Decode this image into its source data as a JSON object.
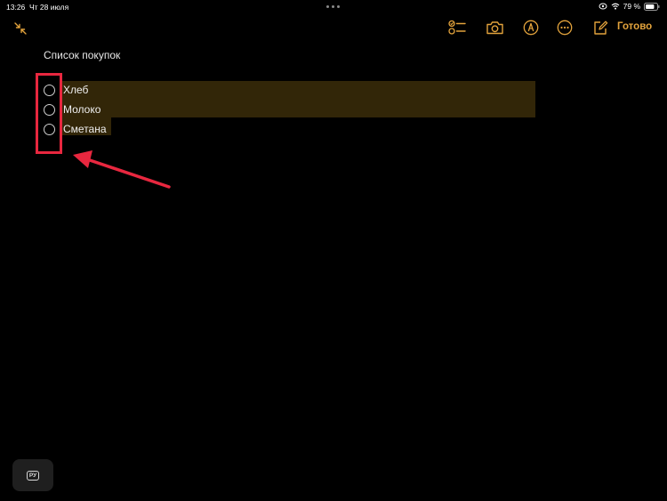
{
  "status_bar": {
    "time": "13:26",
    "date": "Чт 28 июля",
    "battery_percent": "79 %",
    "battery_level": 0.79
  },
  "toolbar": {
    "done_label": "Готово",
    "accent_color": "#e3a33c",
    "icons": [
      "collapse-icon",
      "checklist-icon",
      "camera-icon",
      "markup-icon",
      "more-icon",
      "compose-icon"
    ]
  },
  "note": {
    "title": "Список покупок",
    "highlight_color": "#322608",
    "items": [
      {
        "label": "Хлеб",
        "checked": false
      },
      {
        "label": "Молоко",
        "checked": false
      },
      {
        "label": "Сметана",
        "checked": false
      }
    ]
  },
  "annotation": {
    "color": "#e8273f"
  },
  "keyboard": {
    "language_label": "РУ"
  }
}
